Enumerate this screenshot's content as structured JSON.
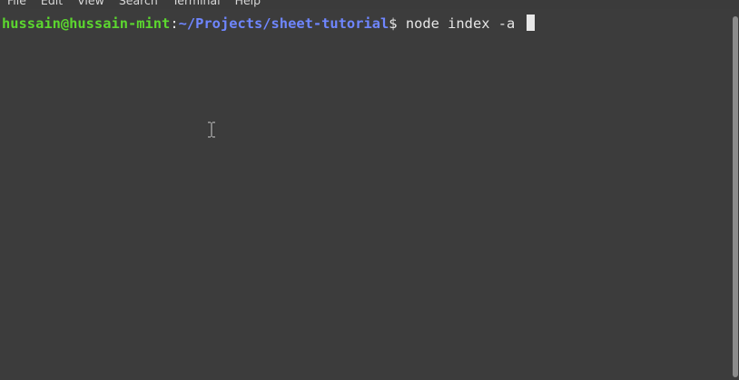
{
  "menubar": {
    "items": [
      "File",
      "Edit",
      "View",
      "Search",
      "Terminal",
      "Help"
    ]
  },
  "terminal": {
    "user_host": "hussain@hussain-mint",
    "separator": ":",
    "path": "~/Projects/sheet-tutorial",
    "prompt_symbol": "$",
    "command": " node index -a ",
    "colors": {
      "user_host": "#5cd72f",
      "path": "#6f86ff",
      "text": "#e6e6e6",
      "background": "#3c3c3c"
    }
  },
  "icons": {
    "text_cursor": "i-beam-cursor-icon"
  }
}
